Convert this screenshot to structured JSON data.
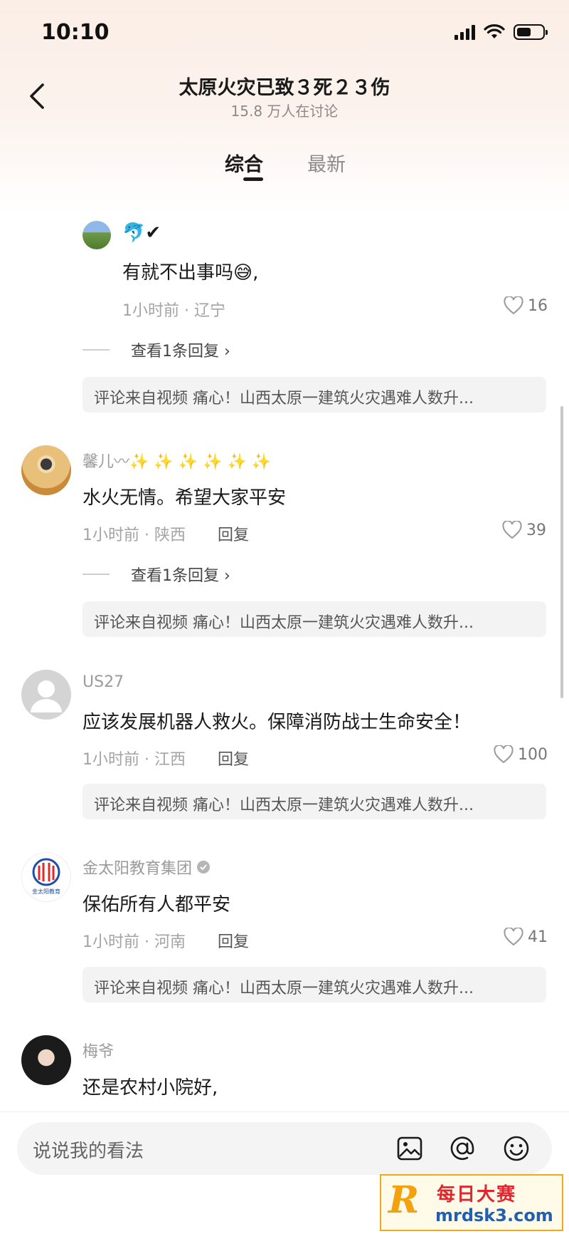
{
  "status_bar": {
    "time": "10:10",
    "battery_level": 0.55
  },
  "header": {
    "title": "太原火灾已致３死２３伤",
    "subtitle": "15.8 万人在讨论"
  },
  "tabs": [
    {
      "label": "综合",
      "active": true
    },
    {
      "label": "最新",
      "active": false
    }
  ],
  "comments": [
    {
      "name": "🐬✔",
      "text": "有就不出事吗😅,",
      "meta": "1小时前 · 辽宁",
      "likes": "16",
      "expand": "查看1条回复 ›",
      "source": "评论来自视频 痛心！山西太原一建筑火灾遇难人数升..."
    },
    {
      "name": "馨儿〰✨ ✨ ✨ ✨ ✨ ✨",
      "text": "水火无情。希望大家平安",
      "meta": "1小时前 · 陕西",
      "reply": "回复",
      "likes": "39",
      "expand": "查看1条回复 ›",
      "source": "评论来自视频 痛心！山西太原一建筑火灾遇难人数升..."
    },
    {
      "name": "US27",
      "text": "应该发展机器人救火。保障消防战士生命安全！",
      "meta": "1小时前 · 江西",
      "reply": "回复",
      "likes": "100",
      "source": "评论来自视频 痛心！山西太原一建筑火灾遇难人数升..."
    },
    {
      "name": "金太阳教育集团",
      "text": "保佑所有人都平安",
      "meta": "1小时前 · 河南",
      "reply": "回复",
      "likes": "41",
      "source": "评论来自视频 痛心！山西太原一建筑火灾遇难人数升...",
      "avatar_caption": "金太阳教育"
    },
    {
      "name": "梅爷",
      "text": "还是农村小院好,"
    }
  ],
  "input": {
    "placeholder": "说说我的看法"
  },
  "watermark": {
    "letter": "R",
    "name": "每日大赛",
    "url": "mrdsk3.com"
  },
  "colors": {
    "like_icon": "#9a9a9a",
    "accent_text": "#1a1a1a",
    "secondary_text": "#a3a3a3"
  }
}
